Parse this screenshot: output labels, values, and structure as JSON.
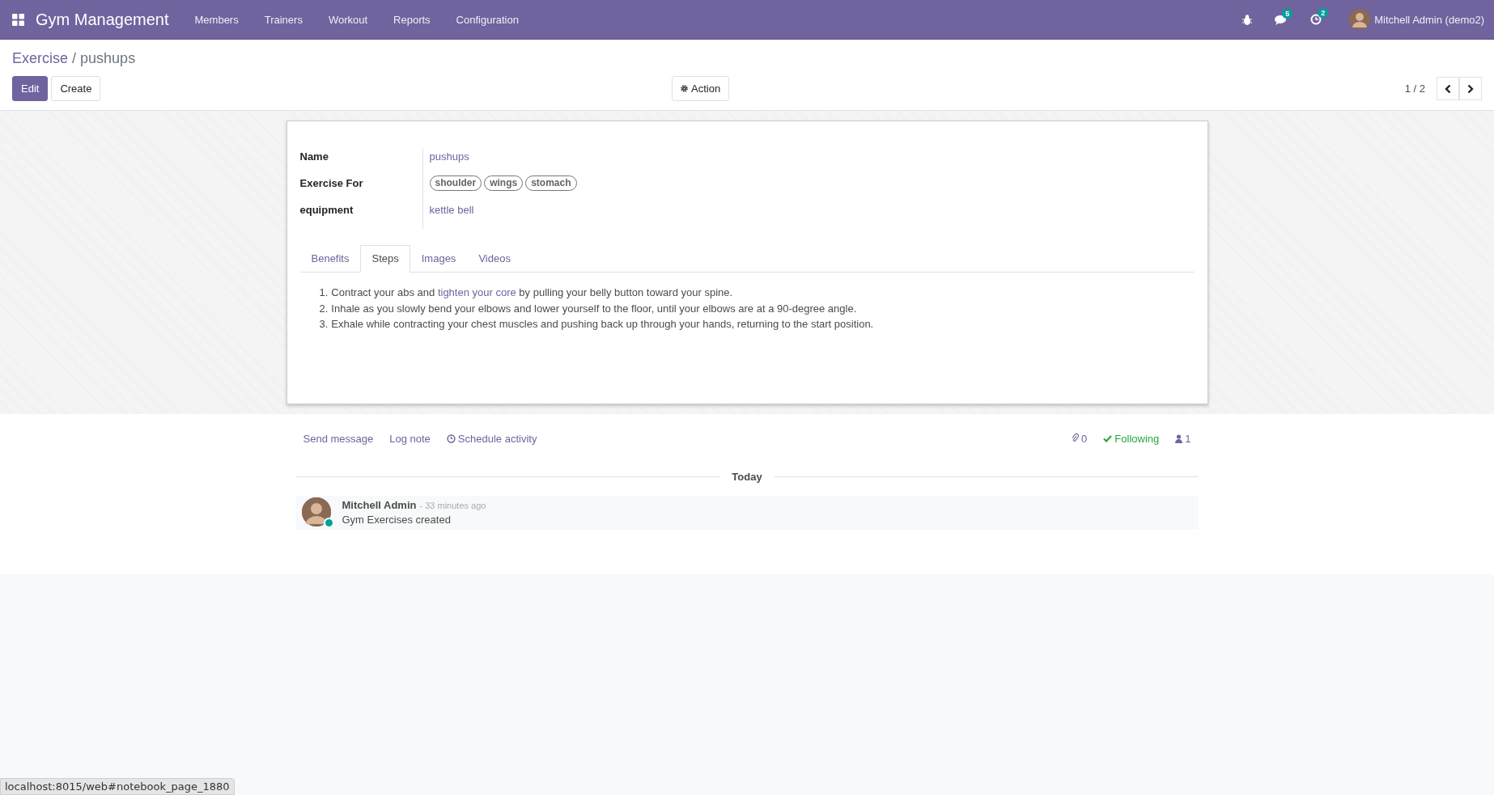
{
  "navbar": {
    "app_title": "Gym Management",
    "menu": [
      "Members",
      "Trainers",
      "Workout",
      "Reports",
      "Configuration"
    ],
    "messages_badge": "5",
    "activities_badge": "2",
    "user": "Mitchell Admin (demo2)"
  },
  "breadcrumb": {
    "parent": "Exercise",
    "separator": "/",
    "current": "pushups"
  },
  "buttons": {
    "edit": "Edit",
    "create": "Create",
    "action": "Action"
  },
  "pager": "1 / 2",
  "form": {
    "fields": [
      {
        "label": "Name",
        "kind": "text",
        "value": "pushups"
      },
      {
        "label": "Exercise For",
        "kind": "tags",
        "tags": [
          "shoulder",
          "wings",
          "stomach"
        ]
      },
      {
        "label": "equipment",
        "kind": "link",
        "value": "kettle bell"
      }
    ],
    "tabs": [
      {
        "label": "Benefits",
        "selected": false
      },
      {
        "label": "Steps",
        "selected": true
      },
      {
        "label": "Images",
        "selected": false
      },
      {
        "label": "Videos",
        "selected": false
      }
    ],
    "steps": [
      {
        "number": "1.",
        "parts": [
          {
            "kind": "text",
            "text": "Contract your abs and "
          },
          {
            "kind": "link",
            "text": "tighten your core"
          },
          {
            "kind": "text",
            "text": " by pulling your belly button toward your spine."
          }
        ]
      },
      {
        "number": "2.",
        "parts": [
          {
            "kind": "text",
            "text": "Inhale as you slowly bend your elbows and lower yourself to the floor, until your elbows are at a 90-degree angle."
          }
        ]
      },
      {
        "number": "3.",
        "parts": [
          {
            "kind": "text",
            "text": "Exhale while contracting your chest muscles and pushing back up through your hands, returning to the start position."
          }
        ]
      }
    ]
  },
  "chatter": {
    "send_message": "Send message",
    "log_note": "Log note",
    "schedule_activity": "Schedule activity",
    "attachments": "0",
    "following": "Following",
    "followers": "1",
    "date_separator": "Today",
    "messages": [
      {
        "author": "Mitchell Admin",
        "time": "- 33 minutes ago",
        "body": "Gym Exercises created",
        "online": true
      }
    ]
  },
  "status_url": "localhost:8015/web#notebook_page_1880"
}
